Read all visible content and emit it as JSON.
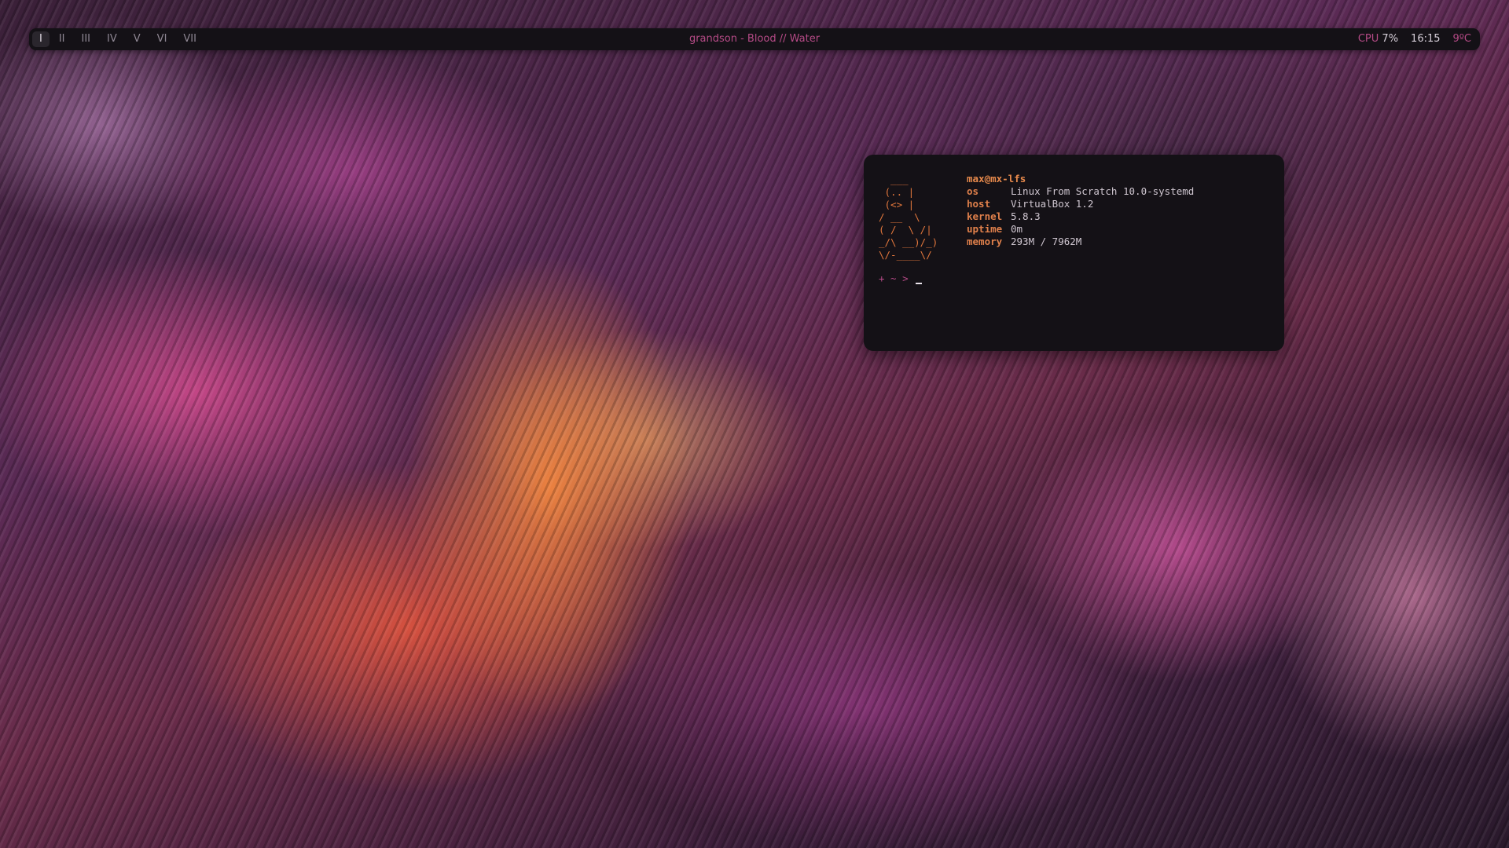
{
  "topbar": {
    "workspaces": [
      {
        "label": "I",
        "active": true
      },
      {
        "label": "II",
        "active": false
      },
      {
        "label": "III",
        "active": false
      },
      {
        "label": "IV",
        "active": false
      },
      {
        "label": "V",
        "active": false
      },
      {
        "label": "VI",
        "active": false
      },
      {
        "label": "VII",
        "active": false
      }
    ],
    "now_playing": "grandson - Blood // Water",
    "cpu_label": "CPU",
    "cpu_value": "7%",
    "clock": "16:15",
    "temperature": "9ºC"
  },
  "terminal": {
    "ascii_logo": "  ___\n (.. |\n (<> |\n/ __  \\\n( /  \\ /|\n_/\\ __)/_)\n\\/-____\\/",
    "user_host": "max@mx-lfs",
    "info": [
      {
        "key": "os",
        "value": "Linux From Scratch 10.0-systemd"
      },
      {
        "key": "host",
        "value": "VirtualBox 1.2"
      },
      {
        "key": "kernel",
        "value": "5.8.3"
      },
      {
        "key": "uptime",
        "value": "0m"
      },
      {
        "key": "memory",
        "value": "293M / 7962M"
      }
    ],
    "prompt": "+ ~ >"
  },
  "colors": {
    "bar_bg": "#141116",
    "accent_pink": "#b54a86",
    "accent_orange": "#e2773c",
    "text_light": "#d8d0da"
  }
}
